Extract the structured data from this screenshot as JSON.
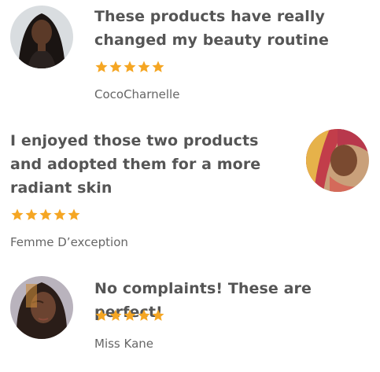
{
  "reviews": [
    {
      "quote": "These products have really changed my beauty routine",
      "rating": 5,
      "author": "CocoCharnelle",
      "avatar_icon": "reviewer-photo"
    },
    {
      "quote": "I enjoyed those two products and adopted them for a more radiant skin",
      "rating": 5,
      "author": "Femme D’exception",
      "avatar_icon": "reviewer-photo"
    },
    {
      "quote": "No complaints! These are perfect!",
      "rating": 5,
      "author": "Miss Kane",
      "avatar_icon": "reviewer-photo"
    }
  ],
  "colors": {
    "star": "#f5a623",
    "text": "#555555"
  }
}
